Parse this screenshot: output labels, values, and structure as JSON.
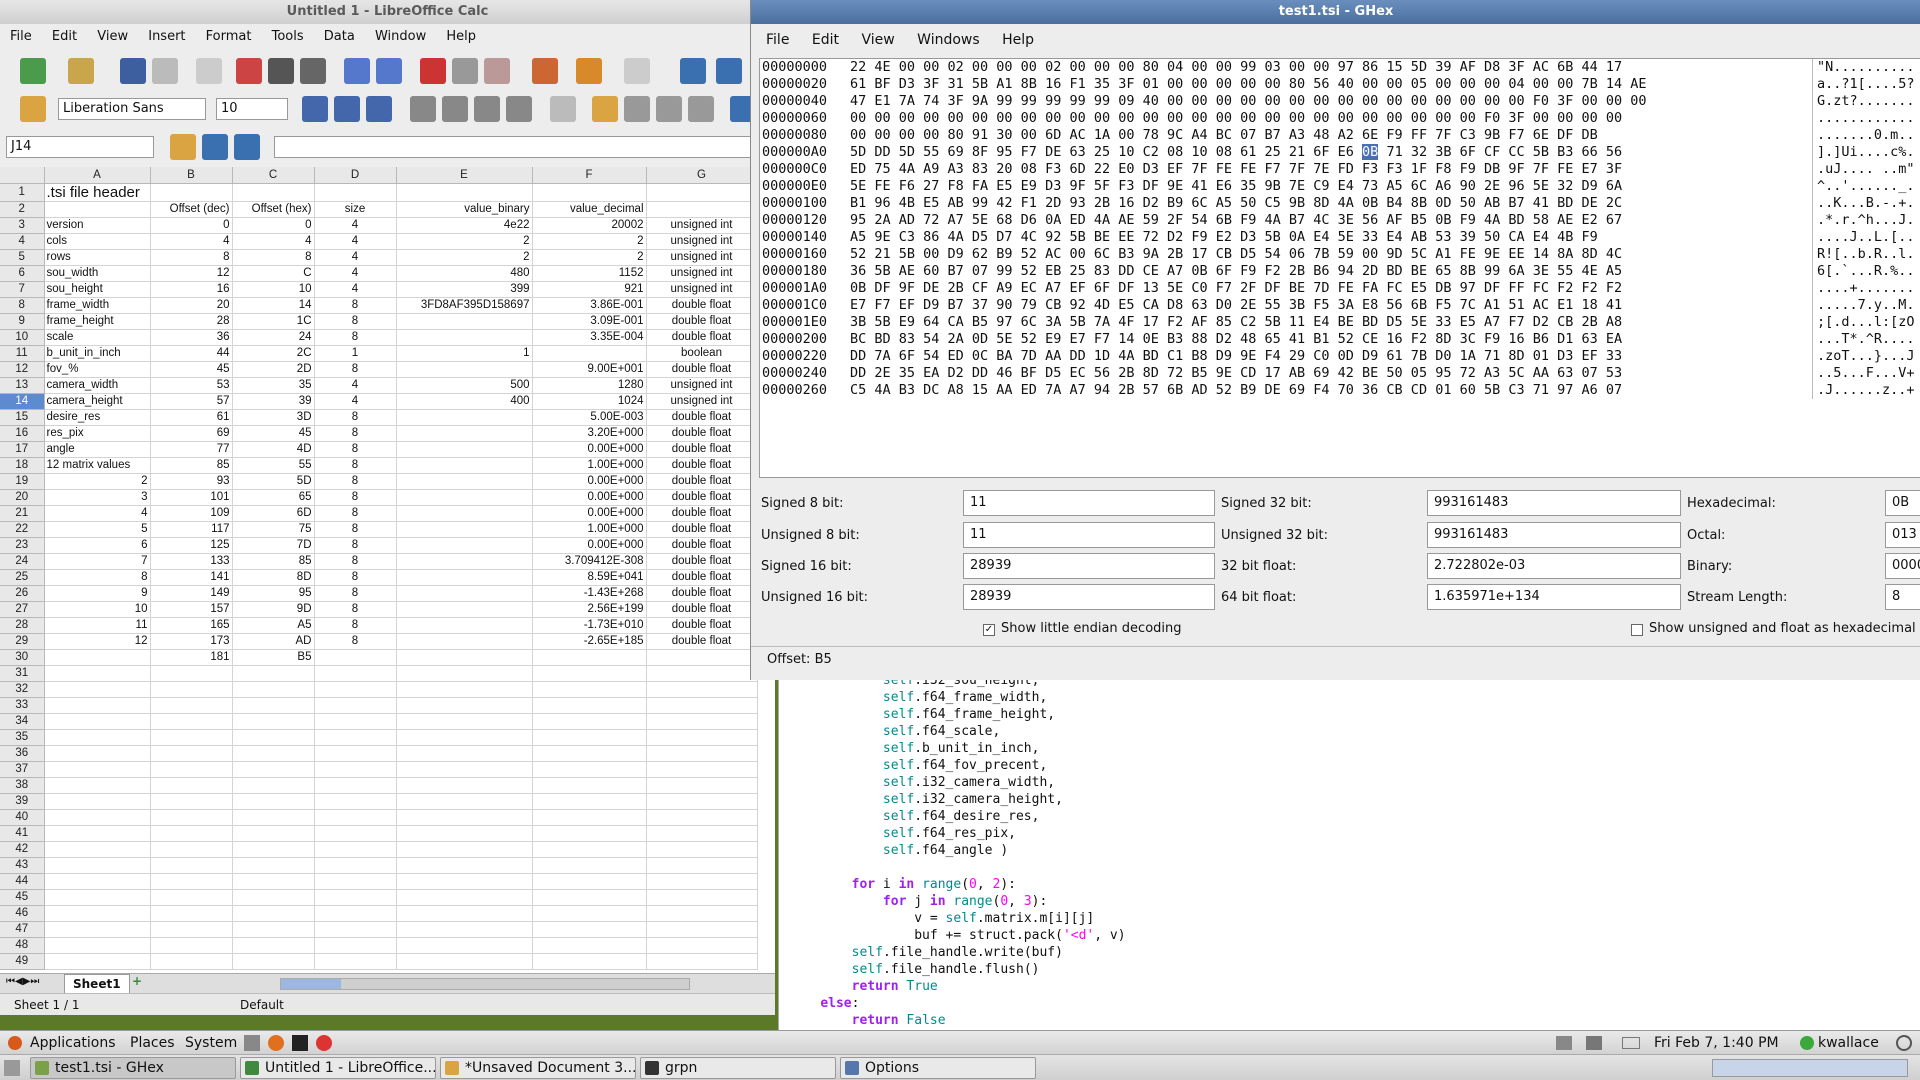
{
  "calc": {
    "title": "Untitled 1 - LibreOffice Calc",
    "menu": [
      "File",
      "Edit",
      "View",
      "Insert",
      "Format",
      "Tools",
      "Data",
      "Window",
      "Help"
    ],
    "font_name": "Liberation Sans",
    "font_size": "10",
    "name_box": "J14",
    "formula": "",
    "col_headers": [
      "A",
      "B",
      "C",
      "D",
      "E",
      "F",
      "G"
    ],
    "rows": [
      {
        "n": "1",
        "a": ".tsi file header",
        "b": "",
        "c": "",
        "d": "",
        "e": "",
        "f": "",
        "g": ""
      },
      {
        "n": "2",
        "a": "",
        "b": "Offset (dec)",
        "c": "Offset (hex)",
        "d": "size",
        "e": "value_binary",
        "f": "value_decimal",
        "g": ""
      },
      {
        "n": "3",
        "a": "version",
        "b": "0",
        "c": "0",
        "d": "4",
        "e": "4e22",
        "f": "20002",
        "g": "unsigned int"
      },
      {
        "n": "4",
        "a": "cols",
        "b": "4",
        "c": "4",
        "d": "4",
        "e": "2",
        "f": "2",
        "g": "unsigned int"
      },
      {
        "n": "5",
        "a": "rows",
        "b": "8",
        "c": "8",
        "d": "4",
        "e": "2",
        "f": "2",
        "g": "unsigned int"
      },
      {
        "n": "6",
        "a": "sou_width",
        "b": "12",
        "c": "C",
        "d": "4",
        "e": "480",
        "f": "1152",
        "g": "unsigned int"
      },
      {
        "n": "7",
        "a": "sou_height",
        "b": "16",
        "c": "10",
        "d": "4",
        "e": "399",
        "f": "921",
        "g": "unsigned int"
      },
      {
        "n": "8",
        "a": "frame_width",
        "b": "20",
        "c": "14",
        "d": "8",
        "e": "3FD8AF395D158697",
        "f": "3.86E-001",
        "g": "double float"
      },
      {
        "n": "9",
        "a": "frame_height",
        "b": "28",
        "c": "1C",
        "d": "8",
        "e": "",
        "f": "3.09E-001",
        "g": "double float"
      },
      {
        "n": "10",
        "a": "scale",
        "b": "36",
        "c": "24",
        "d": "8",
        "e": "",
        "f": "3.35E-004",
        "g": "double float"
      },
      {
        "n": "11",
        "a": "b_unit_in_inch",
        "b": "44",
        "c": "2C",
        "d": "1",
        "e": "1",
        "f": "",
        "g": "boolean"
      },
      {
        "n": "12",
        "a": "fov_%",
        "b": "45",
        "c": "2D",
        "d": "8",
        "e": "",
        "f": "9.00E+001",
        "g": "double float"
      },
      {
        "n": "13",
        "a": "camera_width",
        "b": "53",
        "c": "35",
        "d": "4",
        "e": "500",
        "f": "1280",
        "g": "unsigned int"
      },
      {
        "n": "14",
        "a": "camera_height",
        "b": "57",
        "c": "39",
        "d": "4",
        "e": "400",
        "f": "1024",
        "g": "unsigned int"
      },
      {
        "n": "15",
        "a": "desire_res",
        "b": "61",
        "c": "3D",
        "d": "8",
        "e": "",
        "f": "5.00E-003",
        "g": "double float"
      },
      {
        "n": "16",
        "a": "res_pix",
        "b": "69",
        "c": "45",
        "d": "8",
        "e": "",
        "f": "3.20E+000",
        "g": "double float"
      },
      {
        "n": "17",
        "a": "angle",
        "b": "77",
        "c": "4D",
        "d": "8",
        "e": "",
        "f": "0.00E+000",
        "g": "double float"
      },
      {
        "n": "18",
        "a": "12 matrix values",
        "b": "85",
        "c": "55",
        "d": "8",
        "e": "",
        "f": "1.00E+000",
        "g": "double float"
      },
      {
        "n": "19",
        "a": "2",
        "b": "93",
        "c": "5D",
        "d": "8",
        "e": "",
        "f": "0.00E+000",
        "g": "double float"
      },
      {
        "n": "20",
        "a": "3",
        "b": "101",
        "c": "65",
        "d": "8",
        "e": "",
        "f": "0.00E+000",
        "g": "double float"
      },
      {
        "n": "21",
        "a": "4",
        "b": "109",
        "c": "6D",
        "d": "8",
        "e": "",
        "f": "0.00E+000",
        "g": "double float"
      },
      {
        "n": "22",
        "a": "5",
        "b": "117",
        "c": "75",
        "d": "8",
        "e": "",
        "f": "1.00E+000",
        "g": "double float"
      },
      {
        "n": "23",
        "a": "6",
        "b": "125",
        "c": "7D",
        "d": "8",
        "e": "",
        "f": "0.00E+000",
        "g": "double float"
      },
      {
        "n": "24",
        "a": "7",
        "b": "133",
        "c": "85",
        "d": "8",
        "e": "",
        "f": "3.709412E-308",
        "g": "double float"
      },
      {
        "n": "25",
        "a": "8",
        "b": "141",
        "c": "8D",
        "d": "8",
        "e": "",
        "f": "8.59E+041",
        "g": "double float"
      },
      {
        "n": "26",
        "a": "9",
        "b": "149",
        "c": "95",
        "d": "8",
        "e": "",
        "f": "-1.43E+268",
        "g": "double float"
      },
      {
        "n": "27",
        "a": "10",
        "b": "157",
        "c": "9D",
        "d": "8",
        "e": "",
        "f": "2.56E+199",
        "g": "double float"
      },
      {
        "n": "28",
        "a": "11",
        "b": "165",
        "c": "A5",
        "d": "8",
        "e": "",
        "f": "-1.73E+010",
        "g": "double float"
      },
      {
        "n": "29",
        "a": "12",
        "b": "173",
        "c": "AD",
        "d": "8",
        "e": "",
        "f": "-2.65E+185",
        "g": "double float"
      },
      {
        "n": "30",
        "a": "",
        "b": "181",
        "c": "B5",
        "d": "",
        "e": "",
        "f": "",
        "g": ""
      },
      {
        "n": "31"
      },
      {
        "n": "32"
      },
      {
        "n": "33"
      },
      {
        "n": "34"
      },
      {
        "n": "35"
      },
      {
        "n": "36"
      },
      {
        "n": "37"
      },
      {
        "n": "38"
      },
      {
        "n": "39"
      },
      {
        "n": "40"
      },
      {
        "n": "41"
      },
      {
        "n": "42"
      },
      {
        "n": "43"
      },
      {
        "n": "44"
      },
      {
        "n": "45"
      },
      {
        "n": "46"
      },
      {
        "n": "47"
      },
      {
        "n": "48"
      },
      {
        "n": "49"
      }
    ],
    "sheet_tab": "Sheet1",
    "status_sheet": "Sheet 1 / 1",
    "status_style": "Default"
  },
  "ghex": {
    "title": "test1.tsi - GHex",
    "menu": [
      "File",
      "Edit",
      "View",
      "Windows",
      "Help"
    ],
    "rows": [
      {
        "off": "00000000",
        "hex": "22 4E 00 00 02 00 00 00 02 00 00 00 80 04 00 00 99 03 00 00 97 86 15 5D 39 AF D8 3F AC 6B 44 17",
        "asc": "\"N.........."
      },
      {
        "off": "00000020",
        "hex": "61 BF D3 3F 31 5B A1 8B 16 F1 35 3F 01 00 00 00 00 00 80 56 40 00 00 05 00 00 00 04 00 00 7B 14 AE",
        "asc": "a..?1[....5?"
      },
      {
        "off": "00000040",
        "hex": "47 E1 7A 74 3F 9A 99 99 99 99 99 09 40 00 00 00 00 00 00 00 00 00 00 00 00 00 00 00 F0 3F 00 00 00",
        "asc": "G.zt?......."
      },
      {
        "off": "00000060",
        "hex": "00 00 00 00 00 00 00 00 00 00 00 00 00 00 00 00 00 00 00 00 00 00 00 00 00 00 F0 3F 00 00 00 00",
        "asc": "............"
      },
      {
        "off": "00000080",
        "hex": "00 00 00 00 80 91 30 00 6D AC 1A 00 78 9C A4 BC 07 B7 A3 48 A2 6E F9 FF 7F C3 9B F7 6E DF DB",
        "asc": ".......0.m.."
      },
      {
        "off": "000000A0",
        "hex": "5D DD 5D 55 69 8F 95 F7 DE 63 25 10 C2 08 10 08 61 25 21 6F E6 0B 71 32 3B 6F CF CC 5B B3 66 56",
        "asc": "].]Ui....c%."
      },
      {
        "off": "000000C0",
        "hex": "ED 75 4A A9 A3 83 20 08 F3 6D 22 E0 D3 EF 7F FE FE F7 7F 7E FD F3 F3 1F F8 F9 DB 9F 7F FE E7 3F",
        "asc": ".uJ.... ..m\""
      },
      {
        "off": "000000E0",
        "hex": "5E FE F6 27 F8 FA E5 E9 D3 9F 5F F3 DF 9E 41 E6 35 9B 7E C9 E4 73 A5 6C A6 90 2E 96 5E 32 D9 6A",
        "asc": "^..'......_."
      },
      {
        "off": "00000100",
        "hex": "B1 96 4B E5 AB 99 42 F1 2D 93 2B 16 D2 B9 6C A5 50 C5 9B 8D 4A 0B B4 8B 0D 50 AB B7 41 BD DE 2C",
        "asc": "..K...B.-.+."
      },
      {
        "off": "00000120",
        "hex": "95 2A AD 72 A7 5E 68 D6 0A ED 4A AE 59 2F 54 6B F9 4A B7 4C 3E 56 AF B5 0B F9 4A BD 58 AE E2 67",
        "asc": ".*.r.^h...J."
      },
      {
        "off": "00000140",
        "hex": "A5 9E C3 86 4A D5 D7 4C 92 5B BE EE 72 D2 F9 E2 D3 5B 0A E4 5E 33 E4 AB 53 39 50 CA E4 4B F9",
        "asc": "....J..L.[.."
      },
      {
        "off": "00000160",
        "hex": "52 21 5B 00 D9 62 B9 52 AC 00 6C B3 9A 2B 17 CB D5 54 06 7B 59 00 9D 5C A1 FE 9E EE 14 8A 8D 4C",
        "asc": "R![..b.R..l."
      },
      {
        "off": "00000180",
        "hex": "36 5B AE 60 B7 07 99 52 EB 25 83 DD CE A7 0B 6F F9 F2 2B B6 94 2D BD BE 65 8B 99 6A 3E 55 4E A5",
        "asc": "6[.`...R.%.."
      },
      {
        "off": "000001A0",
        "hex": "0B DF 9F DE 2B CF A9 EC A7 EF 6F DF 13 5E C0 F7 2F DF BE 7D FE FA FC E5 DB 97 DF FF FC F2 F2 F2",
        "asc": "....+......."
      },
      {
        "off": "000001C0",
        "hex": "E7 F7 EF D9 B7 37 90 79 CB 92 4D E5 CA D8 63 D0 2E 55 3B F5 3A E8 56 6B F5 7C A1 51 AC E1 18 41",
        "asc": ".....7.y..M."
      },
      {
        "off": "000001E0",
        "hex": "3B 5B E9 64 CA B5 97 6C 3A 5B 7A 4F 17 F2 AF 85 C2 5B 11 E4 BE BD D5 5E 33 E5 A7 F7 D2 CB 2B A8",
        "asc": ";[.d...l:[zO"
      },
      {
        "off": "00000200",
        "hex": "BC BD 83 54 2A 0D 5E 52 E9 E7 F7 14 0E B3 88 D2 48 65 41 B1 52 CE 16 F2 8D 3C F9 16 B6 D1 63 EA",
        "asc": "...T*.^R...."
      },
      {
        "off": "00000220",
        "hex": "DD 7A 6F 54 ED 0C BA 7D AA DD 1D 4A BD C1 B8 D9 9E F4 29 C0 0D D9 61 7B D0 1A 71 8D 01 D3 EF 33",
        "asc": ".zoT...}...J"
      },
      {
        "off": "00000240",
        "hex": "DD 2E 35 EA D2 DD 46 BF D5 EC 56 2B 8D 72 B5 9E CD 17 AB 69 42 BE 50 05 95 72 A3 5C AA 63 07 53",
        "asc": "..5...F...V+"
      },
      {
        "off": "00000260",
        "hex": "C5 4A B3 DC A8 15 AA ED 7A A7 94 2B 57 6B AD 52 B9 DE 69 F4 70 36 CB CD 01 60 5B C3 71 97 A6 07",
        "asc": ".J......z..+"
      }
    ],
    "info": {
      "signed8_label": "Signed 8 bit:",
      "signed8": "11",
      "unsigned8_label": "Unsigned 8 bit:",
      "unsigned8": "11",
      "signed16_label": "Signed 16 bit:",
      "signed16": "28939",
      "unsigned16_label": "Unsigned 16 bit:",
      "unsigned16": "28939",
      "signed32_label": "Signed 32 bit:",
      "signed32": "993161483",
      "unsigned32_label": "Unsigned 32 bit:",
      "unsigned32": "993161483",
      "float32_label": "32 bit float:",
      "float32": "2.722802e-03",
      "float64_label": "64 bit float:",
      "float64": "1.635971e+134",
      "hex_label": "Hexadecimal:",
      "hex": "0B",
      "octal_label": "Octal:",
      "octal": "013",
      "binary_label": "Binary:",
      "binary": "0000",
      "stream_label": "Stream Length:",
      "stream": "8",
      "little_endian_label": "Show little endian decoding",
      "unsigned_hex_label": "Show unsigned and float as hexadecimal"
    },
    "offset_status": "Offset: B5"
  },
  "editor": {
    "lines": [
      [
        {
          "t": "            "
        },
        {
          "t": "self",
          "c": "slf"
        },
        {
          "t": ".i32_sou_height,"
        }
      ],
      [
        {
          "t": "            "
        },
        {
          "t": "self",
          "c": "slf"
        },
        {
          "t": ".f64_frame_width,"
        }
      ],
      [
        {
          "t": "            "
        },
        {
          "t": "self",
          "c": "slf"
        },
        {
          "t": ".f64_frame_height,"
        }
      ],
      [
        {
          "t": "            "
        },
        {
          "t": "self",
          "c": "slf"
        },
        {
          "t": ".f64_scale,"
        }
      ],
      [
        {
          "t": "            "
        },
        {
          "t": "self",
          "c": "slf"
        },
        {
          "t": ".b_unit_in_inch,"
        }
      ],
      [
        {
          "t": "            "
        },
        {
          "t": "self",
          "c": "slf"
        },
        {
          "t": ".f64_fov_precent,"
        }
      ],
      [
        {
          "t": "            "
        },
        {
          "t": "self",
          "c": "slf"
        },
        {
          "t": ".i32_camera_width,"
        }
      ],
      [
        {
          "t": "            "
        },
        {
          "t": "self",
          "c": "slf"
        },
        {
          "t": ".i32_camera_height,"
        }
      ],
      [
        {
          "t": "            "
        },
        {
          "t": "self",
          "c": "slf"
        },
        {
          "t": ".f64_desire_res,"
        }
      ],
      [
        {
          "t": "            "
        },
        {
          "t": "self",
          "c": "slf"
        },
        {
          "t": ".f64_res_pix,"
        }
      ],
      [
        {
          "t": "            "
        },
        {
          "t": "self",
          "c": "slf"
        },
        {
          "t": ".f64_angle )"
        }
      ],
      [
        {
          "t": ""
        }
      ],
      [
        {
          "t": "        "
        },
        {
          "t": "for",
          "c": "kw"
        },
        {
          "t": " i "
        },
        {
          "t": "in",
          "c": "kw"
        },
        {
          "t": " "
        },
        {
          "t": "range",
          "c": "bi"
        },
        {
          "t": "("
        },
        {
          "t": "0",
          "c": "num"
        },
        {
          "t": ", "
        },
        {
          "t": "2",
          "c": "num"
        },
        {
          "t": "):"
        }
      ],
      [
        {
          "t": "            "
        },
        {
          "t": "for",
          "c": "kw"
        },
        {
          "t": " j "
        },
        {
          "t": "in",
          "c": "kw"
        },
        {
          "t": " "
        },
        {
          "t": "range",
          "c": "bi"
        },
        {
          "t": "("
        },
        {
          "t": "0",
          "c": "num"
        },
        {
          "t": ", "
        },
        {
          "t": "3",
          "c": "num"
        },
        {
          "t": "):"
        }
      ],
      [
        {
          "t": "                v = "
        },
        {
          "t": "self",
          "c": "slf"
        },
        {
          "t": ".matrix.m[i][j]"
        }
      ],
      [
        {
          "t": "                buf += struct.pack("
        },
        {
          "t": "'<d'",
          "c": "str"
        },
        {
          "t": ", v)"
        }
      ],
      [
        {
          "t": "        "
        },
        {
          "t": "self",
          "c": "slf"
        },
        {
          "t": ".file_handle.write(buf)"
        }
      ],
      [
        {
          "t": "        "
        },
        {
          "t": "self",
          "c": "slf"
        },
        {
          "t": ".file_handle.flush()"
        }
      ],
      [
        {
          "t": "        "
        },
        {
          "t": "return",
          "c": "kw"
        },
        {
          "t": " "
        },
        {
          "t": "True",
          "c": "bi"
        }
      ],
      [
        {
          "t": "    "
        },
        {
          "t": "else",
          "c": "kw"
        },
        {
          "t": ":"
        }
      ],
      [
        {
          "t": "        "
        },
        {
          "t": "return",
          "c": "kw"
        },
        {
          "t": " "
        },
        {
          "t": "False",
          "c": "bi"
        }
      ]
    ]
  },
  "panel": {
    "applications": "Applications",
    "places": "Places",
    "system": "System",
    "datetime": "Fri Feb  7,  1:40 PM",
    "user": "kwallace",
    "tasks": [
      {
        "label": "test1.tsi - GHex",
        "active": true,
        "color": "#7aa14a"
      },
      {
        "label": "Untitled 1 - LibreOffice...",
        "active": false,
        "color": "#3f8a3f"
      },
      {
        "label": "*Unsaved Document 3...",
        "active": false,
        "color": "#d9a441"
      },
      {
        "label": "grpn",
        "active": false,
        "color": "#333"
      },
      {
        "label": "Options",
        "active": false,
        "color": "#5577aa"
      }
    ]
  },
  "colors": {
    "hex_selection": "#4a6fb5",
    "ghex_title": "#4a6f9f",
    "desktop": "#5a7a2a"
  }
}
